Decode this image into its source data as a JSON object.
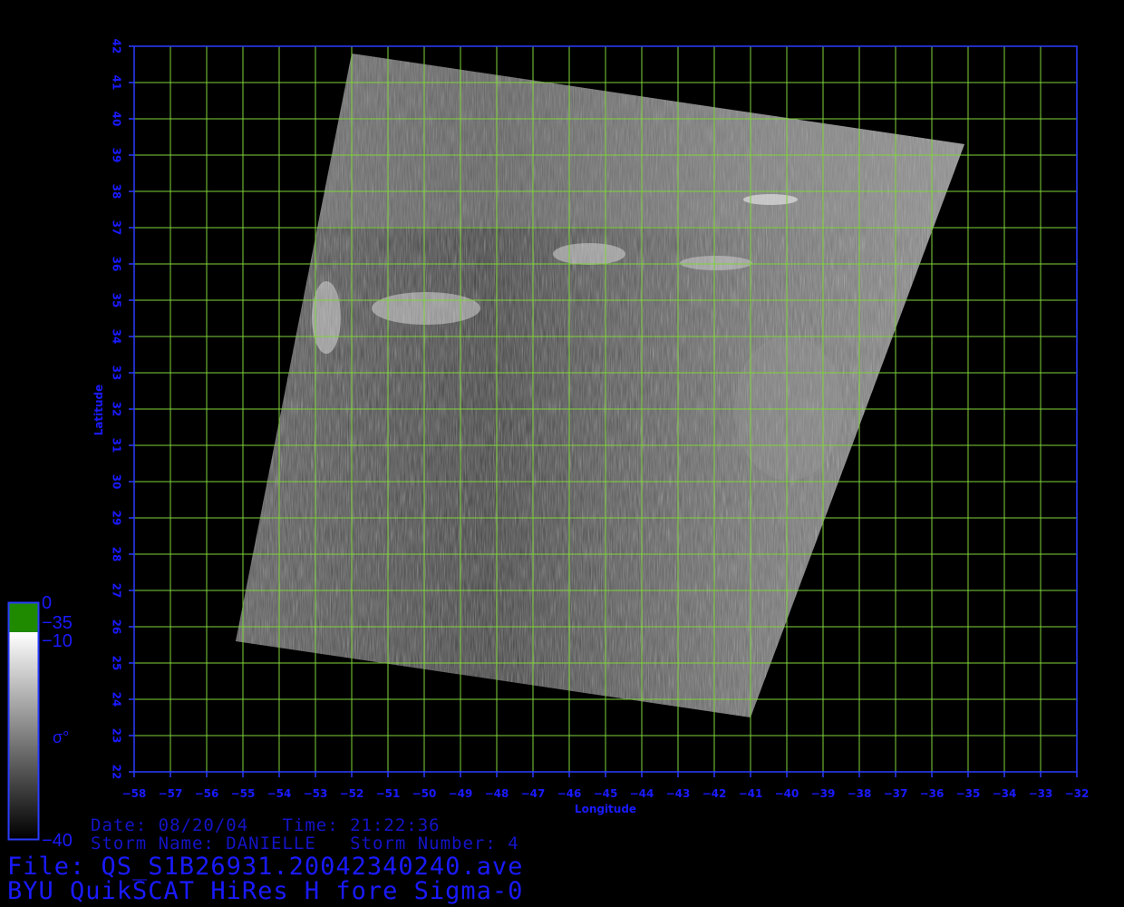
{
  "map": {
    "xlabel": "Longitude",
    "ylabel": "Latitude",
    "lon_range": [
      -58,
      -32
    ],
    "lat_range": [
      22,
      42
    ],
    "lon_ticks": [
      -58,
      -57,
      -56,
      -55,
      -54,
      -53,
      -52,
      -51,
      -50,
      -49,
      -48,
      -47,
      -46,
      -45,
      -44,
      -43,
      -42,
      -41,
      -40,
      -39,
      -38,
      -37,
      -36,
      -35,
      -34,
      -33,
      -32
    ],
    "lat_ticks": [
      22,
      23,
      24,
      25,
      26,
      27,
      28,
      29,
      30,
      31,
      32,
      33,
      34,
      35,
      36,
      37,
      38,
      39,
      40,
      41,
      42
    ],
    "grid": true,
    "grid_color": "#7fd43a",
    "frame_color": "#2a3cff",
    "swath_corners_lonlat": [
      [
        -52,
        41.8
      ],
      [
        -35.1,
        39.3
      ],
      [
        -41.0,
        23.5
      ],
      [
        -55.2,
        25.6
      ]
    ]
  },
  "colorbar": {
    "labels": {
      "top": "0",
      "green_bottom": "−35",
      "white_top": "−10",
      "bottom": "−40",
      "symbol": "σ°"
    },
    "colors": {
      "green": "#1f8a00",
      "white": "#ffffff",
      "black": "#000000"
    }
  },
  "info": {
    "date_line": "Date: 08/20/04   Time: 21:22:36",
    "storm_line": "Storm Name: DANIELLE   Storm Number: 4",
    "file_line": "File: QS_S1B26931.20042340240.ave",
    "product_line": "BYU QuikSCAT HiRes H fore Sigma-0"
  }
}
